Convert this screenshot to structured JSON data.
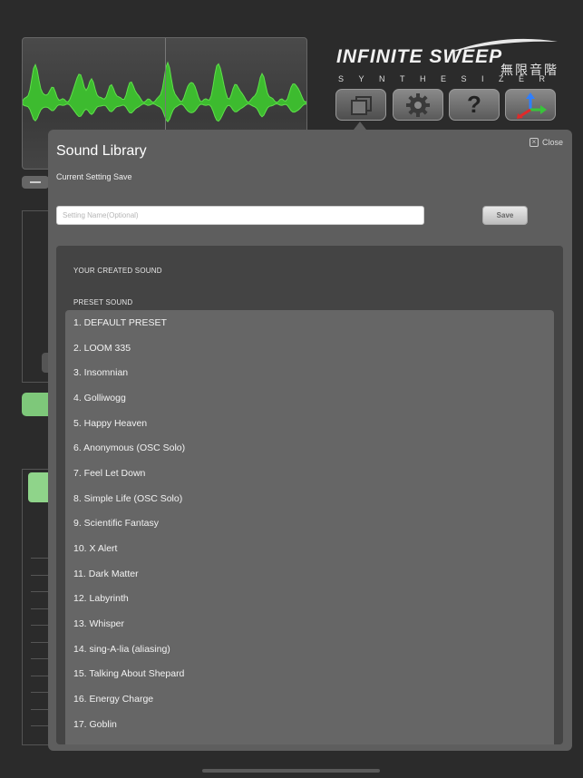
{
  "app": {
    "logo_title": "INFINITE SWEEP",
    "logo_cjk": "無限音階",
    "logo_sub": "SYNTHESIZER",
    "toolbar": [
      {
        "name": "library-button",
        "icon": "pages-icon",
        "label": ""
      },
      {
        "name": "settings-button",
        "icon": "gear-icon",
        "label": ""
      },
      {
        "name": "help-button",
        "icon": "question-icon",
        "label": "?"
      },
      {
        "name": "axis-button",
        "icon": "axis-arrows-icon",
        "label": ""
      }
    ],
    "accent_color": "#3dbb2f"
  },
  "modal": {
    "title": "Sound Library",
    "close_label": "Close",
    "save_section_label": "Current Setting Save",
    "name_placeholder": "Setting Name(Optional)",
    "save_label": "Save",
    "created_label": "YOUR CREATED SOUND",
    "preset_label": "PRESET SOUND",
    "presets": [
      "1. DEFAULT PRESET",
      "2. LOOM 335",
      "3. Insomnian",
      "4. Golliwogg",
      "5. Happy Heaven",
      "6. Anonymous (OSC Solo)",
      "7. Feel Let Down",
      "8. Simple Life (OSC Solo)",
      "9. Scientific Fantasy",
      "10. X Alert",
      "11. Dark Matter",
      "12. Labyrinth",
      "13. Whisper",
      "14. sing-A-lia (aliasing)",
      "15. Talking About Shepard",
      "16. Energy Charge",
      "17. Goblin"
    ]
  }
}
